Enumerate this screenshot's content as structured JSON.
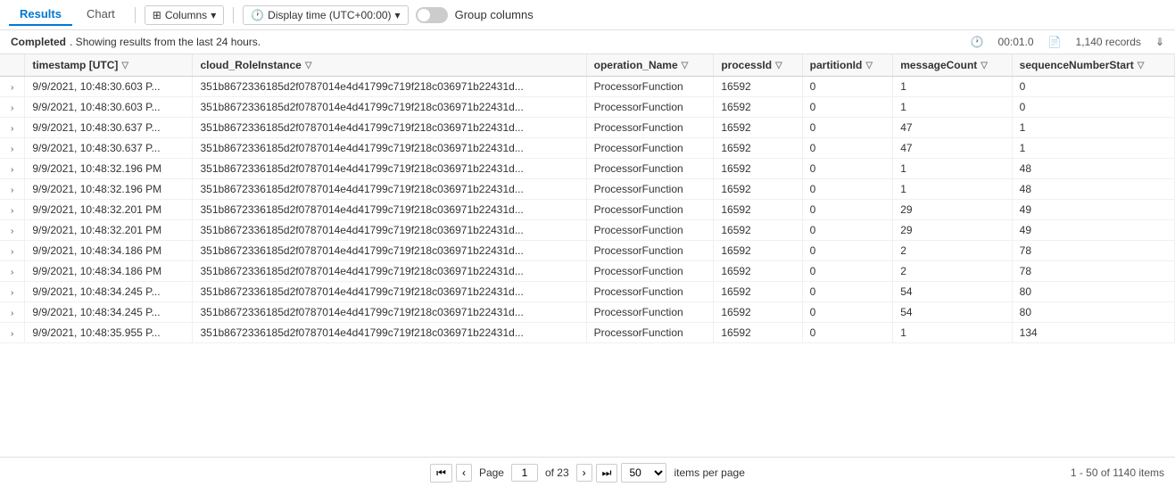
{
  "toolbar": {
    "results_tab": "Results",
    "chart_tab": "Chart",
    "columns_btn": "Columns",
    "display_time_btn": "Display time (UTC+00:00)",
    "group_columns_label": "Group columns"
  },
  "status": {
    "completed_text": "Completed",
    "description": ". Showing results from the last 24 hours.",
    "duration": "00:01.0",
    "records": "1,140 records"
  },
  "columns": [
    {
      "key": "expand",
      "label": ""
    },
    {
      "key": "timestamp",
      "label": "timestamp [UTC]"
    },
    {
      "key": "cloud_RoleInstance",
      "label": "cloud_RoleInstance"
    },
    {
      "key": "operation_Name",
      "label": "operation_Name"
    },
    {
      "key": "processId",
      "label": "processId"
    },
    {
      "key": "partitionId",
      "label": "partitionId"
    },
    {
      "key": "messageCount",
      "label": "messageCount"
    },
    {
      "key": "sequenceNumberStart",
      "label": "sequenceNumberStart"
    }
  ],
  "rows": [
    {
      "timestamp": "9/9/2021, 10:48:30.603 P...",
      "cloud_RoleInstance": "351b8672336185d2f0787014e4d41799c719f218c036971b22431d...",
      "operation_Name": "ProcessorFunction",
      "processId": "16592",
      "partitionId": "0",
      "messageCount": "1",
      "sequenceNumberStart": "0"
    },
    {
      "timestamp": "9/9/2021, 10:48:30.603 P...",
      "cloud_RoleInstance": "351b8672336185d2f0787014e4d41799c719f218c036971b22431d...",
      "operation_Name": "ProcessorFunction",
      "processId": "16592",
      "partitionId": "0",
      "messageCount": "1",
      "sequenceNumberStart": "0"
    },
    {
      "timestamp": "9/9/2021, 10:48:30.637 P...",
      "cloud_RoleInstance": "351b8672336185d2f0787014e4d41799c719f218c036971b22431d...",
      "operation_Name": "ProcessorFunction",
      "processId": "16592",
      "partitionId": "0",
      "messageCount": "47",
      "sequenceNumberStart": "1"
    },
    {
      "timestamp": "9/9/2021, 10:48:30.637 P...",
      "cloud_RoleInstance": "351b8672336185d2f0787014e4d41799c719f218c036971b22431d...",
      "operation_Name": "ProcessorFunction",
      "processId": "16592",
      "partitionId": "0",
      "messageCount": "47",
      "sequenceNumberStart": "1"
    },
    {
      "timestamp": "9/9/2021, 10:48:32.196 PM",
      "cloud_RoleInstance": "351b8672336185d2f0787014e4d41799c719f218c036971b22431d...",
      "operation_Name": "ProcessorFunction",
      "processId": "16592",
      "partitionId": "0",
      "messageCount": "1",
      "sequenceNumberStart": "48"
    },
    {
      "timestamp": "9/9/2021, 10:48:32.196 PM",
      "cloud_RoleInstance": "351b8672336185d2f0787014e4d41799c719f218c036971b22431d...",
      "operation_Name": "ProcessorFunction",
      "processId": "16592",
      "partitionId": "0",
      "messageCount": "1",
      "sequenceNumberStart": "48"
    },
    {
      "timestamp": "9/9/2021, 10:48:32.201 PM",
      "cloud_RoleInstance": "351b8672336185d2f0787014e4d41799c719f218c036971b22431d...",
      "operation_Name": "ProcessorFunction",
      "processId": "16592",
      "partitionId": "0",
      "messageCount": "29",
      "sequenceNumberStart": "49"
    },
    {
      "timestamp": "9/9/2021, 10:48:32.201 PM",
      "cloud_RoleInstance": "351b8672336185d2f0787014e4d41799c719f218c036971b22431d...",
      "operation_Name": "ProcessorFunction",
      "processId": "16592",
      "partitionId": "0",
      "messageCount": "29",
      "sequenceNumberStart": "49"
    },
    {
      "timestamp": "9/9/2021, 10:48:34.186 PM",
      "cloud_RoleInstance": "351b8672336185d2f0787014e4d41799c719f218c036971b22431d...",
      "operation_Name": "ProcessorFunction",
      "processId": "16592",
      "partitionId": "0",
      "messageCount": "2",
      "sequenceNumberStart": "78"
    },
    {
      "timestamp": "9/9/2021, 10:48:34.186 PM",
      "cloud_RoleInstance": "351b8672336185d2f0787014e4d41799c719f218c036971b22431d...",
      "operation_Name": "ProcessorFunction",
      "processId": "16592",
      "partitionId": "0",
      "messageCount": "2",
      "sequenceNumberStart": "78"
    },
    {
      "timestamp": "9/9/2021, 10:48:34.245 P...",
      "cloud_RoleInstance": "351b8672336185d2f0787014e4d41799c719f218c036971b22431d...",
      "operation_Name": "ProcessorFunction",
      "processId": "16592",
      "partitionId": "0",
      "messageCount": "54",
      "sequenceNumberStart": "80"
    },
    {
      "timestamp": "9/9/2021, 10:48:34.245 P...",
      "cloud_RoleInstance": "351b8672336185d2f0787014e4d41799c719f218c036971b22431d...",
      "operation_Name": "ProcessorFunction",
      "processId": "16592",
      "partitionId": "0",
      "messageCount": "54",
      "sequenceNumberStart": "80"
    },
    {
      "timestamp": "9/9/2021, 10:48:35.955 P...",
      "cloud_RoleInstance": "351b8672336185d2f0787014e4d41799c719f218c036971b22431d...",
      "operation_Name": "ProcessorFunction",
      "processId": "16592",
      "partitionId": "0",
      "messageCount": "1",
      "sequenceNumberStart": "134"
    }
  ],
  "pagination": {
    "page_label": "Page",
    "current_page": "1",
    "of_label": "of 23",
    "page_size": "50",
    "items_per_page_label": "items per page",
    "range_label": "1 - 50 of 1140 items",
    "first_label": "⏮",
    "prev_label": "‹",
    "next_label": "›",
    "last_label": "⏭"
  }
}
